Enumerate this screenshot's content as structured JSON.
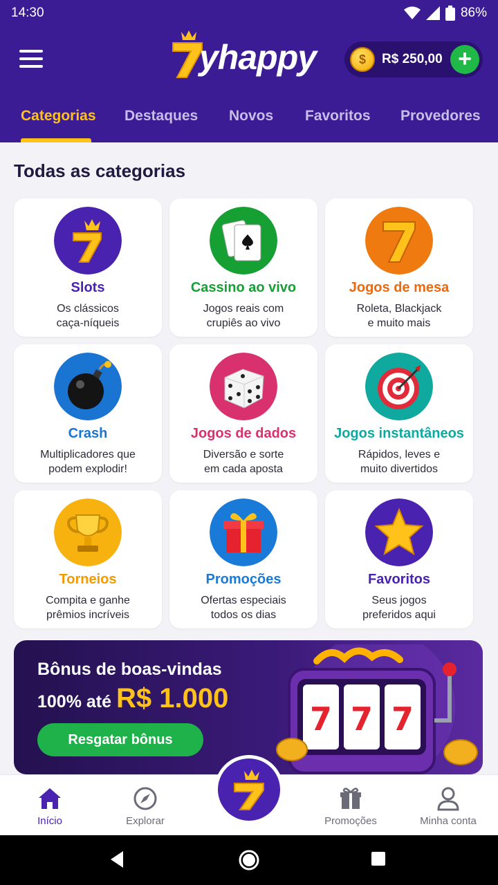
{
  "status_bar": {
    "time": "14:30",
    "battery": "86%"
  },
  "header": {
    "logo_text": "yhappy",
    "balance": "R$ 250,00",
    "coin_symbol": "$",
    "add_symbol": "+"
  },
  "tabs": [
    {
      "label": "Categorias",
      "active": true
    },
    {
      "label": "Destaques"
    },
    {
      "label": "Novos"
    },
    {
      "label": "Favoritos"
    },
    {
      "label": "Provedores"
    }
  ],
  "section_title": "Todas as categorias",
  "categories": [
    {
      "title": "Slots",
      "desc1": "Os clássicos",
      "desc2": "caça-níqueis",
      "color": "#4a22b0",
      "icon": "seven-crown-icon"
    },
    {
      "title": "Cassino ao vivo",
      "desc1": "Jogos reais com",
      "desc2": "crupiês ao vivo",
      "color": "#16a033",
      "icon": "playing-cards-icon"
    },
    {
      "title": "Jogos de mesa",
      "desc1": "Roleta, Blackjack",
      "desc2": "e muito mais",
      "color": "#e96a10",
      "icon": "seven-icon"
    },
    {
      "title": "Crash",
      "desc1": "Multiplicadores que",
      "desc2": "podem explodir!",
      "color": "#1a74d2",
      "icon": "bomb-icon"
    },
    {
      "title": "Jogos de dados",
      "desc1": "Diversão e sorte",
      "desc2": "em cada aposta",
      "color": "#d9306e",
      "icon": "dice-icon"
    },
    {
      "title": "Jogos instantâneos",
      "desc1": "Rápidos, leves e",
      "desc2": "muito divertidos",
      "color": "#0fa9a0",
      "icon": "target-icon"
    },
    {
      "title": "Torneios",
      "desc1": "Compita e ganhe",
      "desc2": "prêmios incríveis",
      "color": "#f29a00",
      "icon": "trophy-icon"
    },
    {
      "title": "Promoções",
      "desc1": "Ofertas especiais",
      "desc2": "todos os dias",
      "color": "#1a7ad8",
      "icon": "gift-icon"
    },
    {
      "title": "Favoritos",
      "desc1": "Seus jogos",
      "desc2": "preferidos aqui",
      "color": "#4a22b0",
      "icon": "star-icon"
    }
  ],
  "banner": {
    "line1": "Bônus de boas-vindas",
    "line2_prefix": "100% até ",
    "amount": "R$ 1.000",
    "button": "Resgatar bônus"
  },
  "bottom_nav": [
    {
      "label": "Início",
      "active": true
    },
    {
      "label": "Explorar"
    },
    {
      "label": "Promoções"
    },
    {
      "label": "Minha conta"
    }
  ]
}
